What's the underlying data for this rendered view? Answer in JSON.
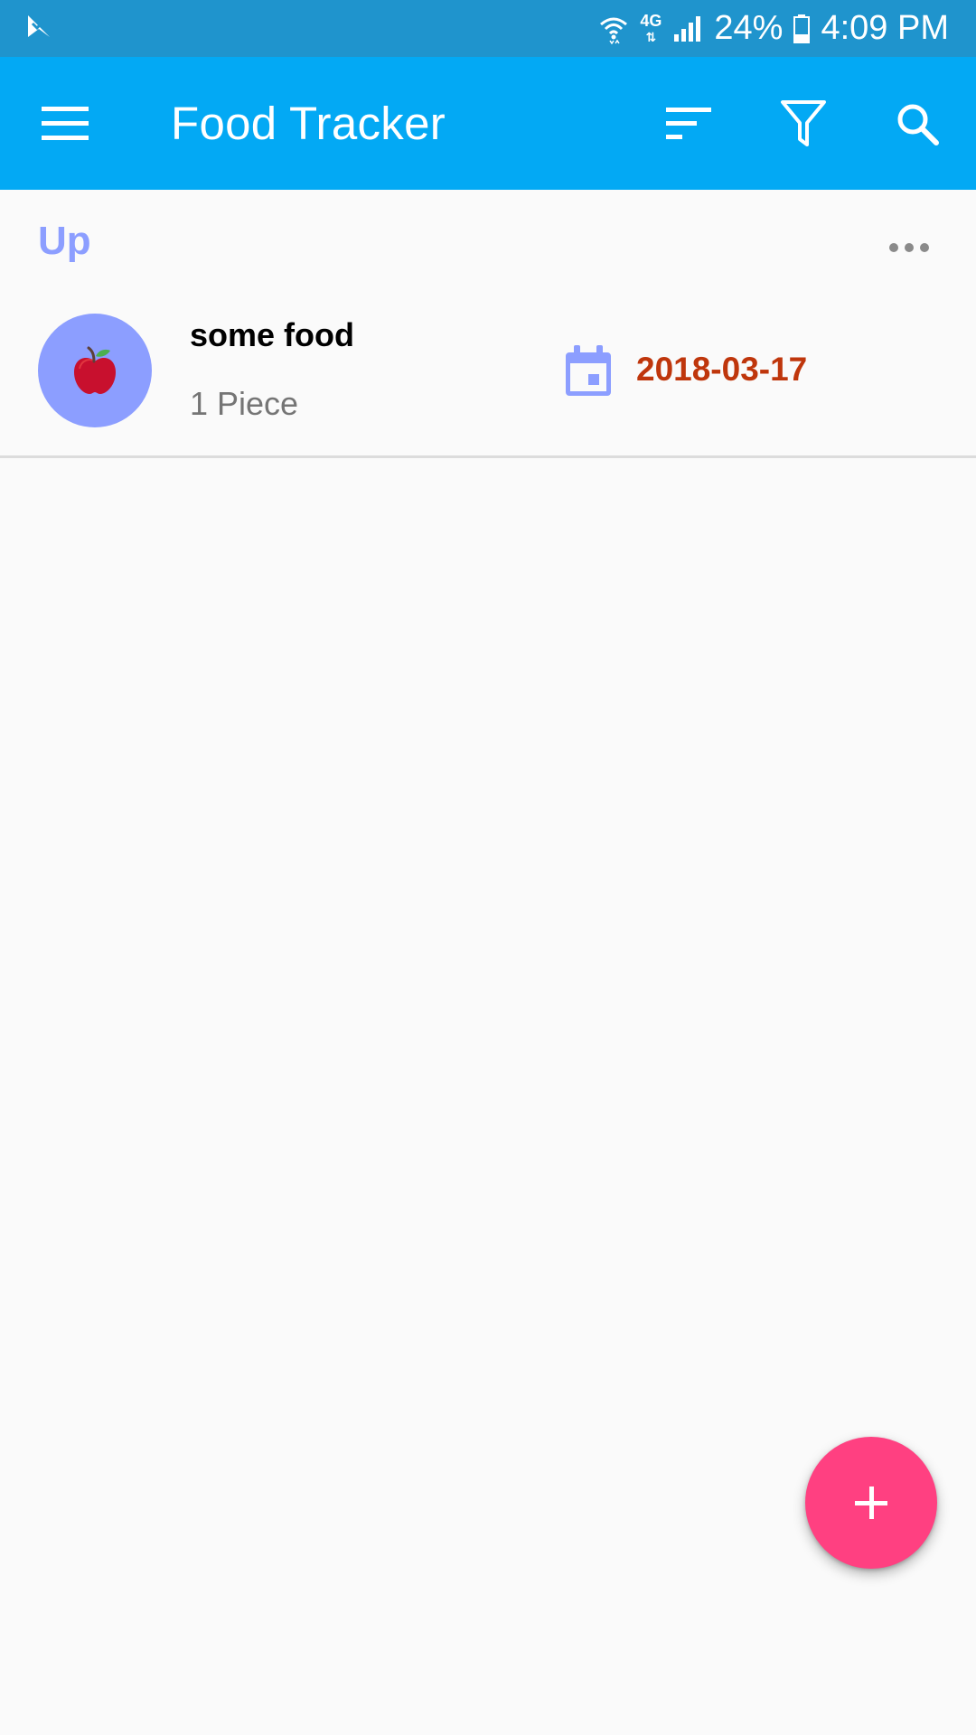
{
  "status_bar": {
    "network_label": "4G",
    "battery": "24%",
    "time": "4:09 PM"
  },
  "app_bar": {
    "title": "Food Tracker",
    "background": "#03a9f4"
  },
  "section": {
    "title": "Up",
    "color": "#8c9eff"
  },
  "items": [
    {
      "name": "some food",
      "quantity": "1 Piece",
      "date": "2018-03-17",
      "icon": "apple-icon",
      "date_color": "#bf360c"
    }
  ],
  "icons": {
    "menu": "hamburger-menu-icon",
    "sort": "sort-icon",
    "filter": "filter-icon",
    "search": "search-icon",
    "more": "more-horizontal-icon",
    "calendar": "calendar-icon",
    "add": "plus-icon"
  },
  "fab_color": "#ff4081"
}
